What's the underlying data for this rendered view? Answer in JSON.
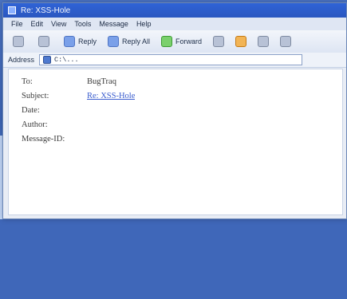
{
  "window": {
    "title": "Re: XSS-Hole"
  },
  "menu": [
    "File",
    "Edit",
    "View",
    "Tools",
    "Message",
    "Help"
  ],
  "toolbar": [
    {
      "label": "",
      "icon": "back-icon"
    },
    {
      "label": "",
      "icon": "forward-icon"
    },
    {
      "label": "Reply",
      "icon": "reply-icon"
    },
    {
      "label": "Reply All",
      "icon": "reply-all-icon"
    },
    {
      "label": "Forward",
      "icon": "forward-mail-icon"
    },
    {
      "label": "",
      "icon": "print-icon"
    },
    {
      "label": "",
      "icon": "delete-icon"
    },
    {
      "label": "",
      "icon": "prev-icon"
    },
    {
      "label": "",
      "icon": "next-icon"
    }
  ],
  "addressbar": {
    "label": "Address",
    "value": "C:\\..."
  },
  "message": {
    "to_label": "To:",
    "to_value": "BugTraq",
    "subject_label": "Subject:",
    "subject_value": "Re: XSS-Hole",
    "date_label": "Date:",
    "date_value": "",
    "author_label": "Author:",
    "author_value": "",
    "message_id_label": "Message-ID:",
    "message_id_value": "",
    "body_lines": [
      "",
      "",
      "",
      "",
      "",
      "",
      ""
    ]
  }
}
